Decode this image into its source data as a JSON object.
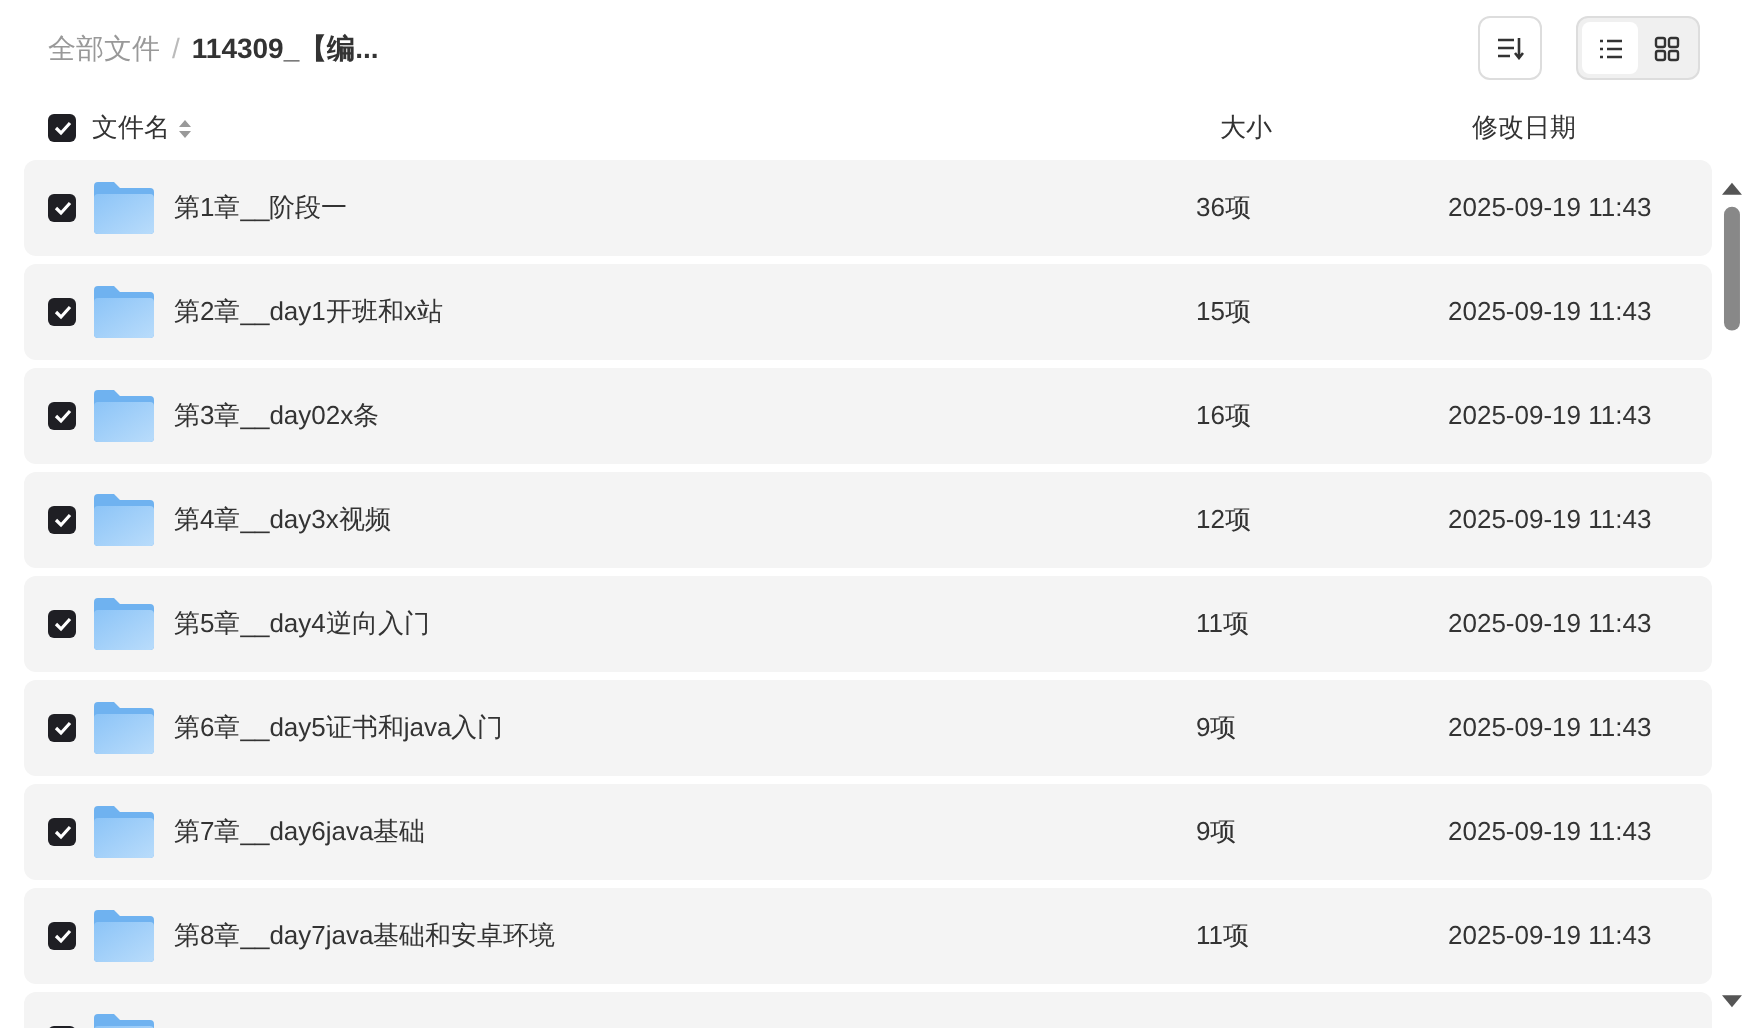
{
  "breadcrumb_separator": "/",
  "breadcrumb": [
    {
      "label": "全部文件",
      "current": false
    },
    {
      "label": "114309_【编...",
      "current": true
    }
  ],
  "views": [
    {
      "kind": "list",
      "selected": true
    },
    {
      "kind": "grid",
      "selected": false
    }
  ],
  "header": {
    "checked": true,
    "name": "文件名",
    "size": "大小",
    "date": "修改日期"
  },
  "rows": [
    {
      "checked": true,
      "name": "第1章__阶段一",
      "size": "36项",
      "date": "2025-09-19 11:43"
    },
    {
      "checked": true,
      "name": "第2章__day1开班和x站",
      "size": "15项",
      "date": "2025-09-19 11:43"
    },
    {
      "checked": true,
      "name": "第3章__day02x条",
      "size": "16项",
      "date": "2025-09-19 11:43"
    },
    {
      "checked": true,
      "name": "第4章__day3x视频",
      "size": "12项",
      "date": "2025-09-19 11:43"
    },
    {
      "checked": true,
      "name": "第5章__day4逆向入门",
      "size": "11项",
      "date": "2025-09-19 11:43"
    },
    {
      "checked": true,
      "name": "第6章__day5证书和java入门",
      "size": "9项",
      "date": "2025-09-19 11:43"
    },
    {
      "checked": true,
      "name": "第7章__day6java基础",
      "size": "9项",
      "date": "2025-09-19 11:43"
    },
    {
      "checked": true,
      "name": "第8章__day7java基础和安卓环境",
      "size": "11项",
      "date": "2025-09-19 11:43"
    },
    {
      "checked": true
    }
  ]
}
